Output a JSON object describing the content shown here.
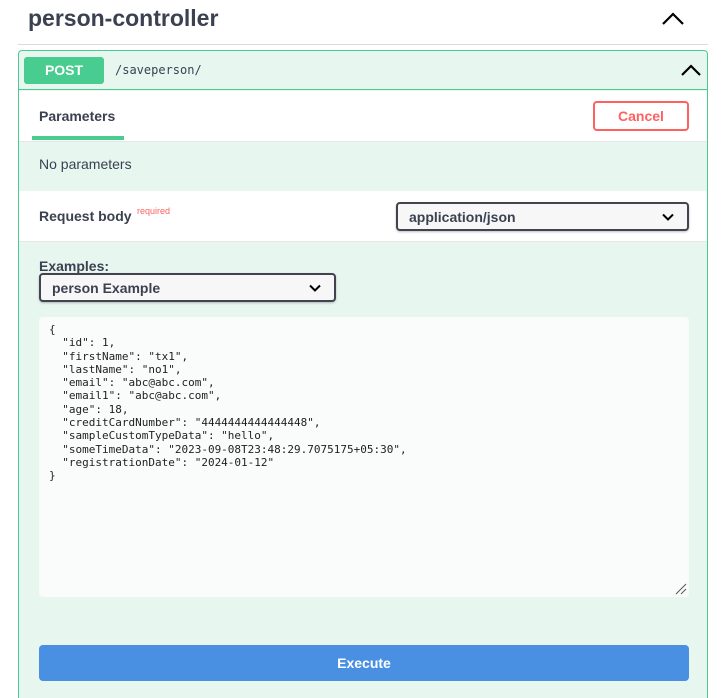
{
  "tag": {
    "title": "person-controller",
    "toggle_icon": "chevron-up-icon"
  },
  "operation": {
    "method": "POST",
    "path": "/saveperson/",
    "toggle_icon": "chevron-up-icon",
    "colors": {
      "method": "#49cc90",
      "background": "#e8f6f0",
      "cancel": "#ff6060",
      "execute": "#4990e2"
    }
  },
  "parameters": {
    "tab_label": "Parameters",
    "cancel_label": "Cancel",
    "empty_text": "No parameters"
  },
  "request_body": {
    "label": "Request body",
    "required_label": "required",
    "content_type": "application/json"
  },
  "examples": {
    "label": "Examples:",
    "selected": "person Example"
  },
  "body_text": "{\n  \"id\": 1,\n  \"firstName\": \"tx1\",\n  \"lastName\": \"no1\",\n  \"email\": \"abc@abc.com\",\n  \"email1\": \"abc@abc.com\",\n  \"age\": 18,\n  \"creditCardNumber\": \"4444444444444448\",\n  \"sampleCustomTypeData\": \"hello\",\n  \"someTimeData\": \"2023-09-08T23:48:29.7075175+05:30\",\n  \"registrationDate\": \"2024-01-12\"\n}",
  "execute_label": "Execute"
}
